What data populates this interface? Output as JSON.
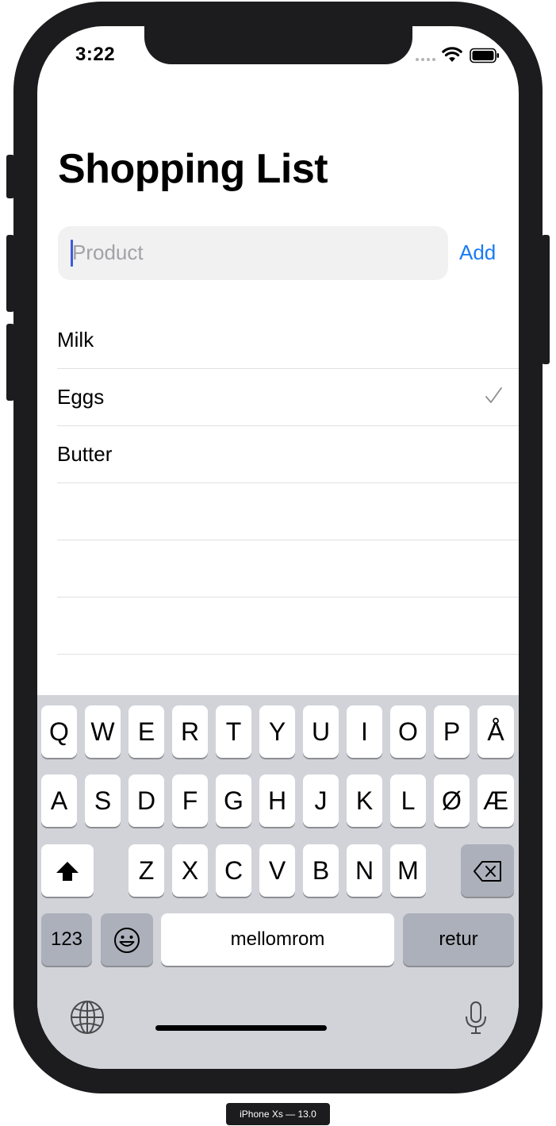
{
  "status_bar": {
    "time": "3:22"
  },
  "page": {
    "title": "Shopping List"
  },
  "input": {
    "placeholder": "Product",
    "value": ""
  },
  "actions": {
    "add_label": "Add"
  },
  "list": {
    "items": [
      {
        "label": "Milk",
        "checked": false
      },
      {
        "label": "Eggs",
        "checked": true
      },
      {
        "label": "Butter",
        "checked": false
      },
      {
        "label": "",
        "checked": false
      },
      {
        "label": "",
        "checked": false
      },
      {
        "label": "",
        "checked": false
      }
    ]
  },
  "keyboard": {
    "row1": [
      "Q",
      "W",
      "E",
      "R",
      "T",
      "Y",
      "U",
      "I",
      "O",
      "P",
      "Å"
    ],
    "row2": [
      "A",
      "S",
      "D",
      "F",
      "G",
      "H",
      "J",
      "K",
      "L",
      "Ø",
      "Æ"
    ],
    "row3": [
      "Z",
      "X",
      "C",
      "V",
      "B",
      "N",
      "M"
    ],
    "numbers_label": "123",
    "space_label": "mellomrom",
    "return_label": "retur",
    "icons": {
      "shift": "shift-icon",
      "delete": "backspace-icon",
      "emoji": "emoji-icon",
      "globe": "globe-icon",
      "mic": "microphone-icon"
    }
  },
  "device": {
    "label": "iPhone Xs — 13.0"
  },
  "colors": {
    "accent": "#1a7cf5",
    "caret": "#3a5bd9",
    "keyboard_bg": "#d1d3d9"
  }
}
